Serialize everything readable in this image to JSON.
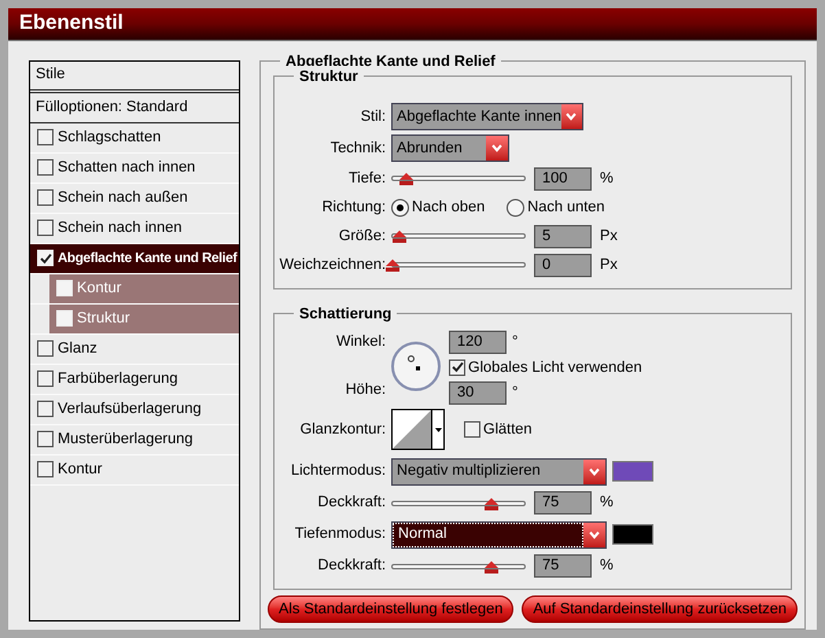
{
  "window": {
    "title": "Ebenenstil"
  },
  "styles_list": {
    "header": "Stile",
    "blending": "Fülloptionen: Standard",
    "items": [
      {
        "label": "Schlagschatten",
        "checked": false,
        "selected": false
      },
      {
        "label": "Schatten nach innen",
        "checked": false,
        "selected": false
      },
      {
        "label": "Schein nach außen",
        "checked": false,
        "selected": false
      },
      {
        "label": "Schein nach innen",
        "checked": false,
        "selected": false
      },
      {
        "label": "Abgeflachte Kante und Relief",
        "checked": true,
        "selected": true,
        "children": [
          {
            "label": "Kontur",
            "checked": false,
            "selected": false
          },
          {
            "label": "Struktur",
            "checked": false,
            "selected": false
          }
        ]
      },
      {
        "label": "Glanz",
        "checked": false,
        "selected": false
      },
      {
        "label": "Farbüberlagerung",
        "checked": false,
        "selected": false
      },
      {
        "label": "Verlaufsüberlagerung",
        "checked": false,
        "selected": false
      },
      {
        "label": "Musterüberlagerung",
        "checked": false,
        "selected": false
      },
      {
        "label": "Kontur",
        "checked": false,
        "selected": false
      }
    ]
  },
  "panel": {
    "title": "Abgeflachte Kante und Relief",
    "structure": {
      "title": "Struktur",
      "style": {
        "label": "Stil:",
        "value": "Abgeflachte Kante innen",
        "focused": false
      },
      "technique": {
        "label": "Technik:",
        "value": "Abrunden",
        "focused": false
      },
      "depth": {
        "label": "Tiefe:",
        "level": 0.1,
        "value": "100",
        "unit": "%"
      },
      "direction": {
        "label": "Richtung:",
        "options": [
          {
            "label": "Nach oben",
            "selected": true
          },
          {
            "label": "Nach unten",
            "selected": false
          }
        ]
      },
      "size": {
        "label": "Größe:",
        "level": 0.05,
        "value": "5",
        "unit": "Px"
      },
      "soften": {
        "label": "Weichzeichnen:",
        "level": 0,
        "value": "0",
        "unit": "Px"
      }
    },
    "shading": {
      "title": "Schattierung",
      "angle": {
        "label": "Winkel:",
        "value": "120",
        "unit": "°"
      },
      "global_light": {
        "label": "Globales Licht verwenden",
        "checked": true
      },
      "altitude": {
        "label": "Höhe:",
        "value": "30",
        "unit": "°"
      },
      "gloss_contour": {
        "label": "Glanzkontur:"
      },
      "antialiased": {
        "label": "Glätten",
        "checked": false
      },
      "highlight_mode": {
        "label": "Lichtermodus:",
        "value": "Negativ multiplizieren",
        "color": "#6f4ab8",
        "focused": false
      },
      "highlight_opacity": {
        "label": "Deckkraft:",
        "level": 0.75,
        "value": "75",
        "unit": "%"
      },
      "shadow_mode": {
        "label": "Tiefenmodus:",
        "value": "Normal",
        "color": "#000000",
        "focused": true
      },
      "shadow_opacity": {
        "label": "Deckkraft:",
        "level": 0.75,
        "value": "75",
        "unit": "%"
      }
    }
  },
  "buttons": [
    "Als Standardeinstellung festlegen",
    "Auf Standardeinstellung zurücksetzen"
  ]
}
